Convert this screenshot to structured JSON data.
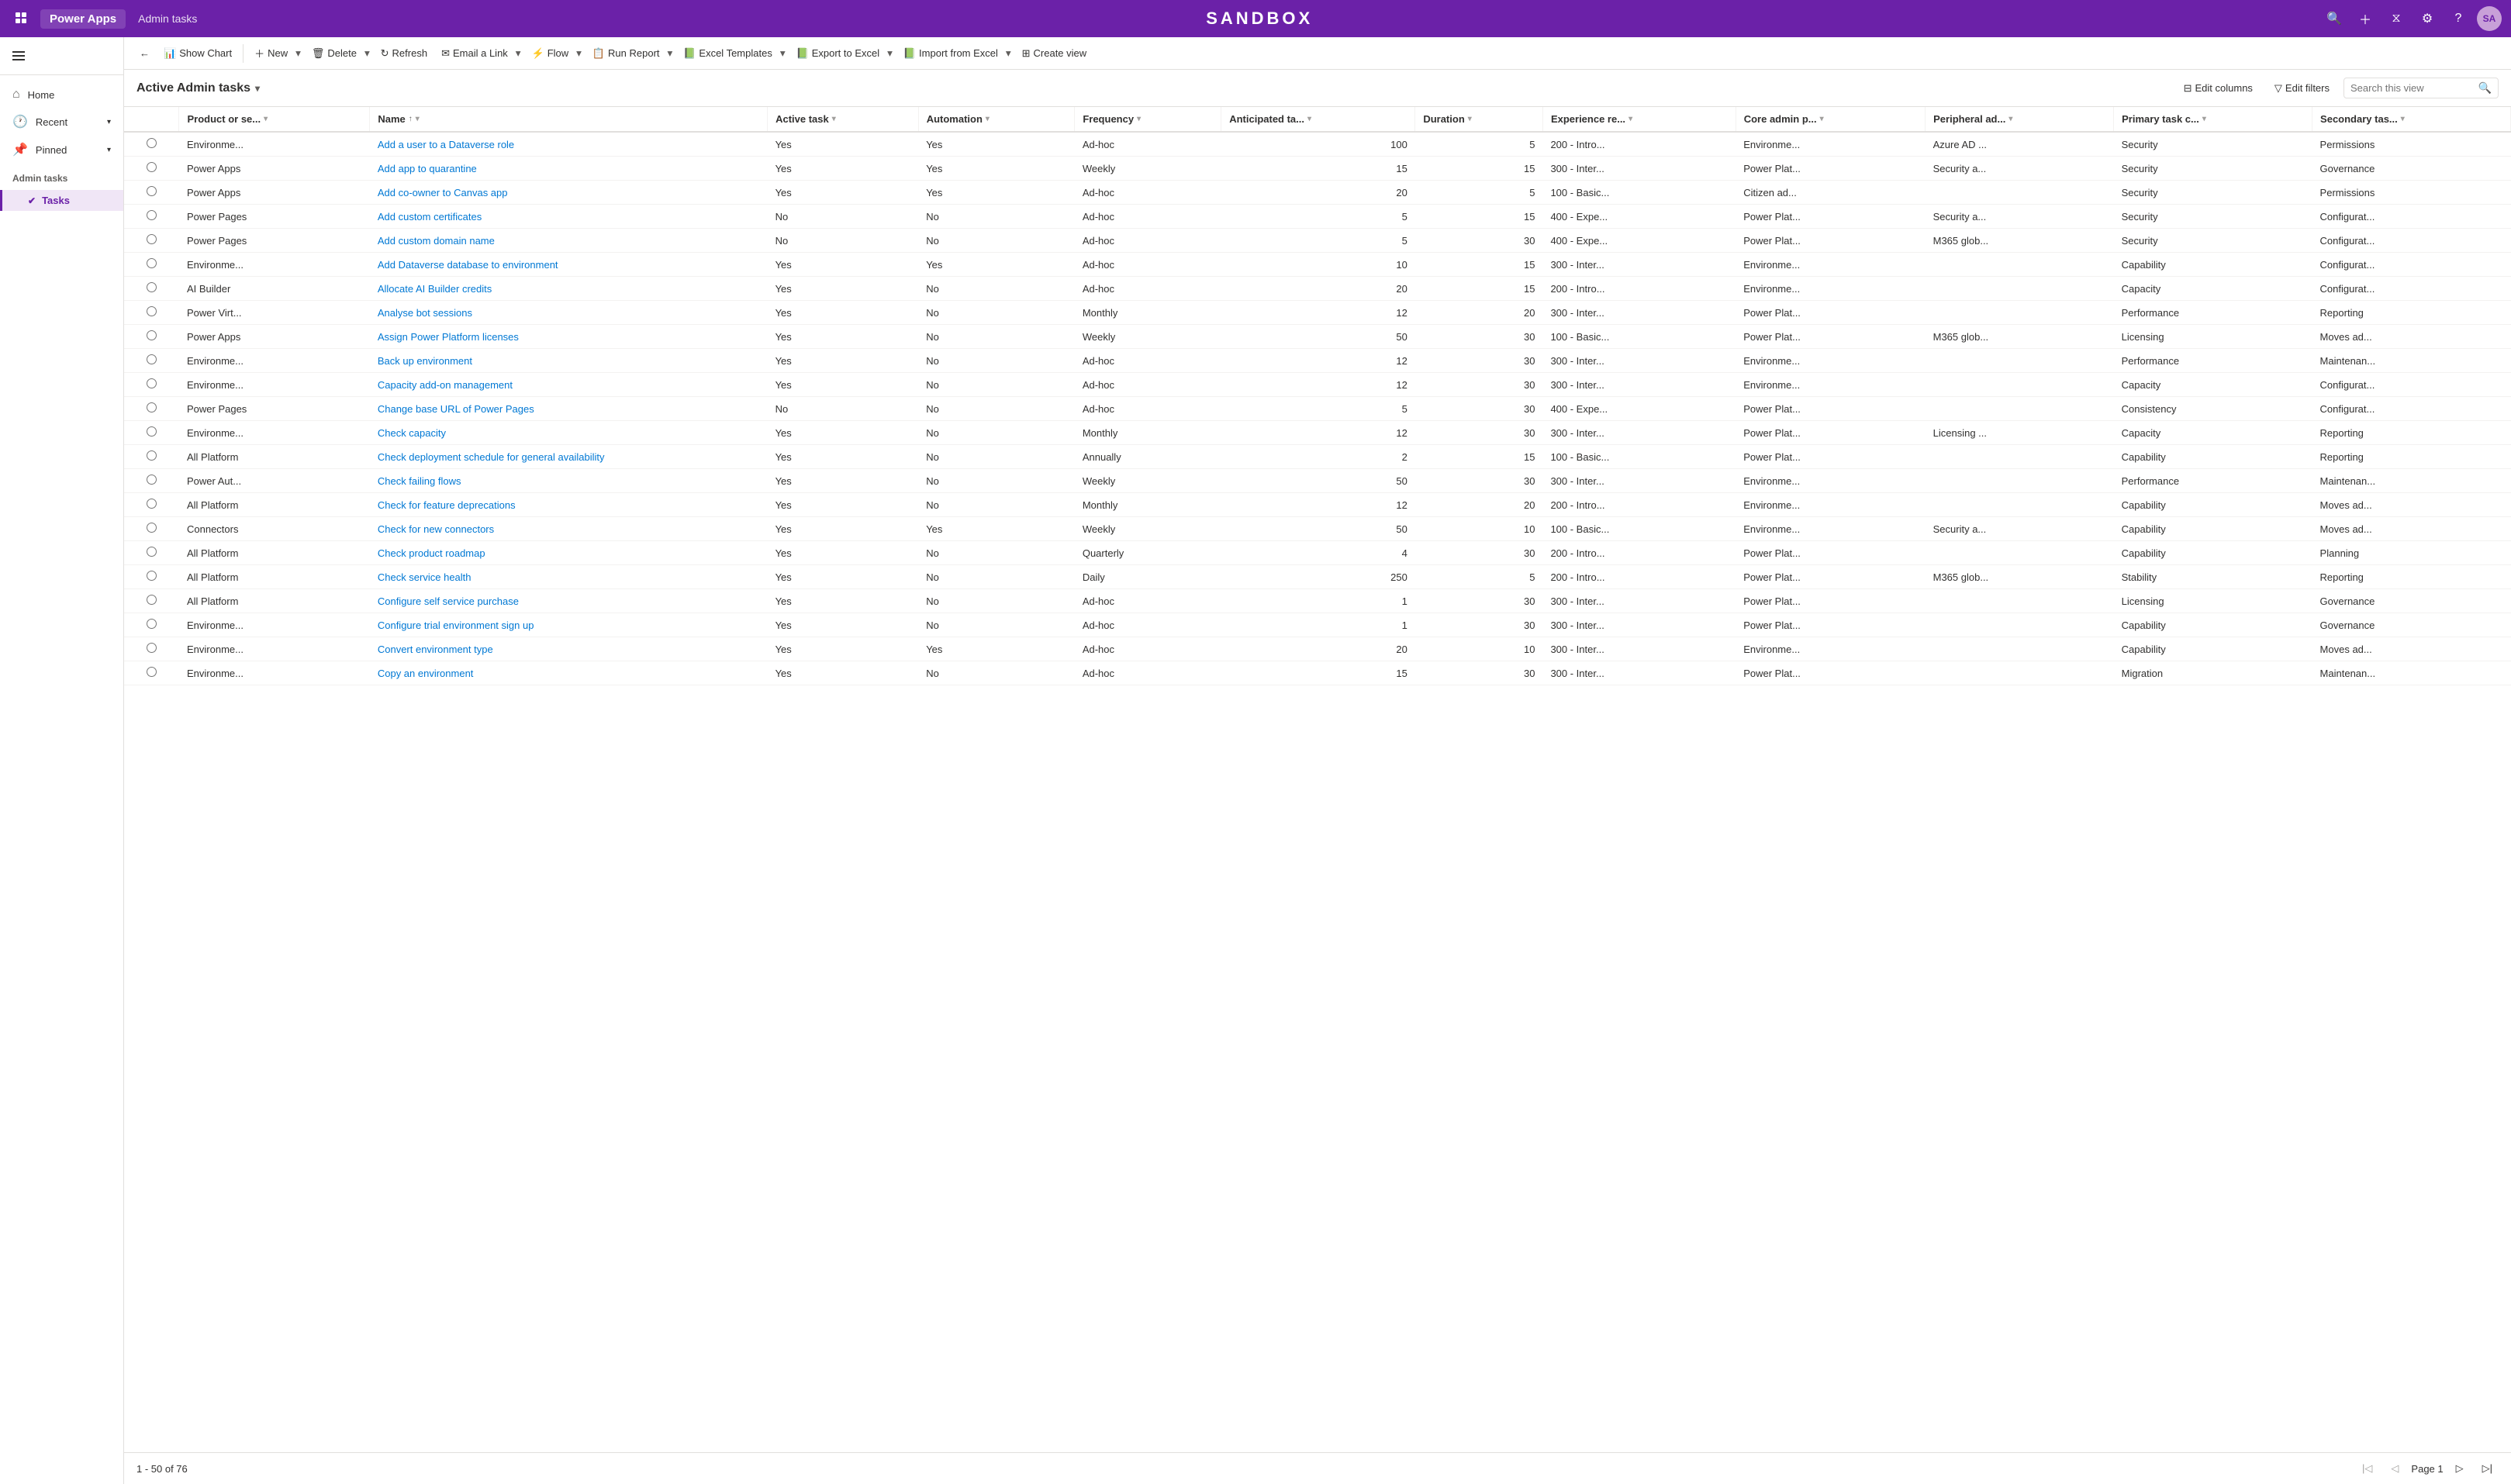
{
  "app": {
    "name": "Power Apps",
    "page": "Admin tasks",
    "sandbox": "SANDBOX",
    "avatar": "SA"
  },
  "sidebar": {
    "nav": [
      {
        "label": "Home",
        "icon": "⌂"
      },
      {
        "label": "Recent",
        "icon": "🕐",
        "hasChevron": true
      },
      {
        "label": "Pinned",
        "icon": "📌",
        "hasChevron": true
      }
    ],
    "section": "Admin tasks",
    "subItems": [
      {
        "label": "Tasks",
        "active": true
      }
    ]
  },
  "toolbar": {
    "back_label": "←",
    "show_chart_label": "Show Chart",
    "new_label": "New",
    "delete_label": "Delete",
    "refresh_label": "Refresh",
    "email_link_label": "Email a Link",
    "flow_label": "Flow",
    "run_report_label": "Run Report",
    "excel_templates_label": "Excel Templates",
    "export_excel_label": "Export to Excel",
    "import_excel_label": "Import from Excel",
    "create_view_label": "Create view"
  },
  "view": {
    "title": "Active Admin tasks",
    "edit_columns_label": "Edit columns",
    "edit_filters_label": "Edit filters",
    "search_placeholder": "Search this view"
  },
  "columns": [
    {
      "key": "product",
      "label": "Product or se..."
    },
    {
      "key": "name",
      "label": "Name"
    },
    {
      "key": "active",
      "label": "Active task"
    },
    {
      "key": "automation",
      "label": "Automation"
    },
    {
      "key": "frequency",
      "label": "Frequency"
    },
    {
      "key": "anticipated",
      "label": "Anticipated ta..."
    },
    {
      "key": "duration",
      "label": "Duration"
    },
    {
      "key": "experience",
      "label": "Experience re..."
    },
    {
      "key": "core",
      "label": "Core admin p..."
    },
    {
      "key": "peripheral",
      "label": "Peripheral ad..."
    },
    {
      "key": "primary",
      "label": "Primary task c..."
    },
    {
      "key": "secondary",
      "label": "Secondary tas..."
    }
  ],
  "rows": [
    {
      "product": "Environme...",
      "name": "Add a user to a Dataverse role",
      "active": "Yes",
      "automation": "Yes",
      "frequency": "Ad-hoc",
      "anticipated": 100,
      "duration": 5,
      "experience": "200 - Intro...",
      "core": "Environme...",
      "peripheral": "Azure AD ...",
      "primary": "Security",
      "secondary": "Permissions"
    },
    {
      "product": "Power Apps",
      "name": "Add app to quarantine",
      "active": "Yes",
      "automation": "Yes",
      "frequency": "Weekly",
      "anticipated": 15,
      "duration": 15,
      "experience": "300 - Inter...",
      "core": "Power Plat...",
      "peripheral": "Security a...",
      "primary": "Security",
      "secondary": "Governance"
    },
    {
      "product": "Power Apps",
      "name": "Add co-owner to Canvas app",
      "active": "Yes",
      "automation": "Yes",
      "frequency": "Ad-hoc",
      "anticipated": 20,
      "duration": 5,
      "experience": "100 - Basic...",
      "core": "Citizen ad...",
      "peripheral": "",
      "primary": "Security",
      "secondary": "Permissions"
    },
    {
      "product": "Power Pages",
      "name": "Add custom certificates",
      "active": "No",
      "automation": "No",
      "frequency": "Ad-hoc",
      "anticipated": 5,
      "duration": 15,
      "experience": "400 - Expe...",
      "core": "Power Plat...",
      "peripheral": "Security a...",
      "primary": "Security",
      "secondary": "Configurat..."
    },
    {
      "product": "Power Pages",
      "name": "Add custom domain name",
      "active": "No",
      "automation": "No",
      "frequency": "Ad-hoc",
      "anticipated": 5,
      "duration": 30,
      "experience": "400 - Expe...",
      "core": "Power Plat...",
      "peripheral": "M365 glob...",
      "primary": "Security",
      "secondary": "Configurat..."
    },
    {
      "product": "Environme...",
      "name": "Add Dataverse database to environment",
      "active": "Yes",
      "automation": "Yes",
      "frequency": "Ad-hoc",
      "anticipated": 10,
      "duration": 15,
      "experience": "300 - Inter...",
      "core": "Environme...",
      "peripheral": "",
      "primary": "Capability",
      "secondary": "Configurat..."
    },
    {
      "product": "AI Builder",
      "name": "Allocate AI Builder credits",
      "active": "Yes",
      "automation": "No",
      "frequency": "Ad-hoc",
      "anticipated": 20,
      "duration": 15,
      "experience": "200 - Intro...",
      "core": "Environme...",
      "peripheral": "",
      "primary": "Capacity",
      "secondary": "Configurat..."
    },
    {
      "product": "Power Virt...",
      "name": "Analyse bot sessions",
      "active": "Yes",
      "automation": "No",
      "frequency": "Monthly",
      "anticipated": 12,
      "duration": 20,
      "experience": "300 - Inter...",
      "core": "Power Plat...",
      "peripheral": "",
      "primary": "Performance",
      "secondary": "Reporting"
    },
    {
      "product": "Power Apps",
      "name": "Assign Power Platform licenses",
      "active": "Yes",
      "automation": "No",
      "frequency": "Weekly",
      "anticipated": 50,
      "duration": 30,
      "experience": "100 - Basic...",
      "core": "Power Plat...",
      "peripheral": "M365 glob...",
      "primary": "Licensing",
      "secondary": "Moves ad..."
    },
    {
      "product": "Environme...",
      "name": "Back up environment",
      "active": "Yes",
      "automation": "No",
      "frequency": "Ad-hoc",
      "anticipated": 12,
      "duration": 30,
      "experience": "300 - Inter...",
      "core": "Environme...",
      "peripheral": "",
      "primary": "Performance",
      "secondary": "Maintenan..."
    },
    {
      "product": "Environme...",
      "name": "Capacity add-on management",
      "active": "Yes",
      "automation": "No",
      "frequency": "Ad-hoc",
      "anticipated": 12,
      "duration": 30,
      "experience": "300 - Inter...",
      "core": "Environme...",
      "peripheral": "",
      "primary": "Capacity",
      "secondary": "Configurat..."
    },
    {
      "product": "Power Pages",
      "name": "Change base URL of Power Pages",
      "active": "No",
      "automation": "No",
      "frequency": "Ad-hoc",
      "anticipated": 5,
      "duration": 30,
      "experience": "400 - Expe...",
      "core": "Power Plat...",
      "peripheral": "",
      "primary": "Consistency",
      "secondary": "Configurat..."
    },
    {
      "product": "Environme...",
      "name": "Check capacity",
      "active": "Yes",
      "automation": "No",
      "frequency": "Monthly",
      "anticipated": 12,
      "duration": 30,
      "experience": "300 - Inter...",
      "core": "Power Plat...",
      "peripheral": "Licensing ...",
      "primary": "Capacity",
      "secondary": "Reporting"
    },
    {
      "product": "All Platform",
      "name": "Check deployment schedule for general availability",
      "active": "Yes",
      "automation": "No",
      "frequency": "Annually",
      "anticipated": 2,
      "duration": 15,
      "experience": "100 - Basic...",
      "core": "Power Plat...",
      "peripheral": "",
      "primary": "Capability",
      "secondary": "Reporting"
    },
    {
      "product": "Power Aut...",
      "name": "Check failing flows",
      "active": "Yes",
      "automation": "No",
      "frequency": "Weekly",
      "anticipated": 50,
      "duration": 30,
      "experience": "300 - Inter...",
      "core": "Environme...",
      "peripheral": "",
      "primary": "Performance",
      "secondary": "Maintenan..."
    },
    {
      "product": "All Platform",
      "name": "Check for feature deprecations",
      "active": "Yes",
      "automation": "No",
      "frequency": "Monthly",
      "anticipated": 12,
      "duration": 20,
      "experience": "200 - Intro...",
      "core": "Environme...",
      "peripheral": "",
      "primary": "Capability",
      "secondary": "Moves ad..."
    },
    {
      "product": "Connectors",
      "name": "Check for new connectors",
      "active": "Yes",
      "automation": "Yes",
      "frequency": "Weekly",
      "anticipated": 50,
      "duration": 10,
      "experience": "100 - Basic...",
      "core": "Environme...",
      "peripheral": "Security a...",
      "primary": "Capability",
      "secondary": "Moves ad..."
    },
    {
      "product": "All Platform",
      "name": "Check product roadmap",
      "active": "Yes",
      "automation": "No",
      "frequency": "Quarterly",
      "anticipated": 4,
      "duration": 30,
      "experience": "200 - Intro...",
      "core": "Power Plat...",
      "peripheral": "",
      "primary": "Capability",
      "secondary": "Planning"
    },
    {
      "product": "All Platform",
      "name": "Check service health",
      "active": "Yes",
      "automation": "No",
      "frequency": "Daily",
      "anticipated": 250,
      "duration": 5,
      "experience": "200 - Intro...",
      "core": "Power Plat...",
      "peripheral": "M365 glob...",
      "primary": "Stability",
      "secondary": "Reporting"
    },
    {
      "product": "All Platform",
      "name": "Configure self service purchase",
      "active": "Yes",
      "automation": "No",
      "frequency": "Ad-hoc",
      "anticipated": 1,
      "duration": 30,
      "experience": "300 - Inter...",
      "core": "Power Plat...",
      "peripheral": "",
      "primary": "Licensing",
      "secondary": "Governance"
    },
    {
      "product": "Environme...",
      "name": "Configure trial environment sign up",
      "active": "Yes",
      "automation": "No",
      "frequency": "Ad-hoc",
      "anticipated": 1,
      "duration": 30,
      "experience": "300 - Inter...",
      "core": "Power Plat...",
      "peripheral": "",
      "primary": "Capability",
      "secondary": "Governance"
    },
    {
      "product": "Environme...",
      "name": "Convert environment type",
      "active": "Yes",
      "automation": "Yes",
      "frequency": "Ad-hoc",
      "anticipated": 20,
      "duration": 10,
      "experience": "300 - Inter...",
      "core": "Environme...",
      "peripheral": "",
      "primary": "Capability",
      "secondary": "Moves ad..."
    },
    {
      "product": "Environme...",
      "name": "Copy an environment",
      "active": "Yes",
      "automation": "No",
      "frequency": "Ad-hoc",
      "anticipated": 15,
      "duration": 30,
      "experience": "300 - Inter...",
      "core": "Power Plat...",
      "peripheral": "",
      "primary": "Migration",
      "secondary": "Maintenan..."
    }
  ],
  "pagination": {
    "info": "1 - 50 of 76",
    "page_label": "Page 1"
  }
}
